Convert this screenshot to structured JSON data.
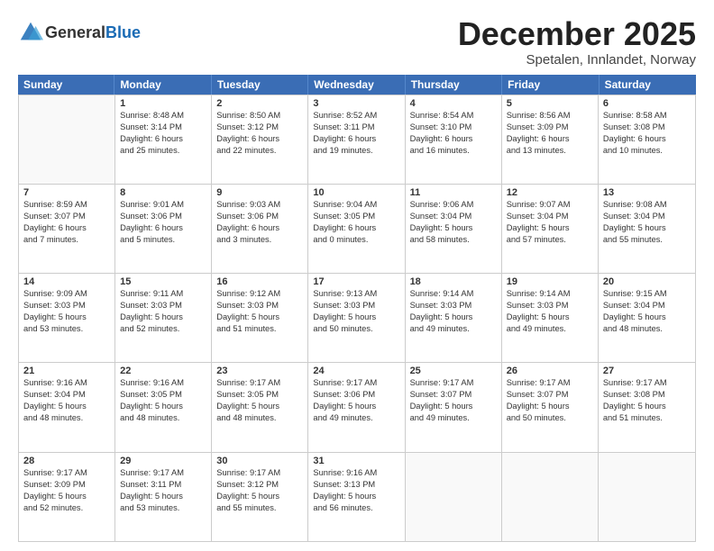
{
  "header": {
    "logo_general": "General",
    "logo_blue": "Blue",
    "month": "December 2025",
    "location": "Spetalen, Innlandet, Norway"
  },
  "weekdays": [
    "Sunday",
    "Monday",
    "Tuesday",
    "Wednesday",
    "Thursday",
    "Friday",
    "Saturday"
  ],
  "rows": [
    [
      {
        "day": "",
        "lines": []
      },
      {
        "day": "1",
        "lines": [
          "Sunrise: 8:48 AM",
          "Sunset: 3:14 PM",
          "Daylight: 6 hours",
          "and 25 minutes."
        ]
      },
      {
        "day": "2",
        "lines": [
          "Sunrise: 8:50 AM",
          "Sunset: 3:12 PM",
          "Daylight: 6 hours",
          "and 22 minutes."
        ]
      },
      {
        "day": "3",
        "lines": [
          "Sunrise: 8:52 AM",
          "Sunset: 3:11 PM",
          "Daylight: 6 hours",
          "and 19 minutes."
        ]
      },
      {
        "day": "4",
        "lines": [
          "Sunrise: 8:54 AM",
          "Sunset: 3:10 PM",
          "Daylight: 6 hours",
          "and 16 minutes."
        ]
      },
      {
        "day": "5",
        "lines": [
          "Sunrise: 8:56 AM",
          "Sunset: 3:09 PM",
          "Daylight: 6 hours",
          "and 13 minutes."
        ]
      },
      {
        "day": "6",
        "lines": [
          "Sunrise: 8:58 AM",
          "Sunset: 3:08 PM",
          "Daylight: 6 hours",
          "and 10 minutes."
        ]
      }
    ],
    [
      {
        "day": "7",
        "lines": [
          "Sunrise: 8:59 AM",
          "Sunset: 3:07 PM",
          "Daylight: 6 hours",
          "and 7 minutes."
        ]
      },
      {
        "day": "8",
        "lines": [
          "Sunrise: 9:01 AM",
          "Sunset: 3:06 PM",
          "Daylight: 6 hours",
          "and 5 minutes."
        ]
      },
      {
        "day": "9",
        "lines": [
          "Sunrise: 9:03 AM",
          "Sunset: 3:06 PM",
          "Daylight: 6 hours",
          "and 3 minutes."
        ]
      },
      {
        "day": "10",
        "lines": [
          "Sunrise: 9:04 AM",
          "Sunset: 3:05 PM",
          "Daylight: 6 hours",
          "and 0 minutes."
        ]
      },
      {
        "day": "11",
        "lines": [
          "Sunrise: 9:06 AM",
          "Sunset: 3:04 PM",
          "Daylight: 5 hours",
          "and 58 minutes."
        ]
      },
      {
        "day": "12",
        "lines": [
          "Sunrise: 9:07 AM",
          "Sunset: 3:04 PM",
          "Daylight: 5 hours",
          "and 57 minutes."
        ]
      },
      {
        "day": "13",
        "lines": [
          "Sunrise: 9:08 AM",
          "Sunset: 3:04 PM",
          "Daylight: 5 hours",
          "and 55 minutes."
        ]
      }
    ],
    [
      {
        "day": "14",
        "lines": [
          "Sunrise: 9:09 AM",
          "Sunset: 3:03 PM",
          "Daylight: 5 hours",
          "and 53 minutes."
        ]
      },
      {
        "day": "15",
        "lines": [
          "Sunrise: 9:11 AM",
          "Sunset: 3:03 PM",
          "Daylight: 5 hours",
          "and 52 minutes."
        ]
      },
      {
        "day": "16",
        "lines": [
          "Sunrise: 9:12 AM",
          "Sunset: 3:03 PM",
          "Daylight: 5 hours",
          "and 51 minutes."
        ]
      },
      {
        "day": "17",
        "lines": [
          "Sunrise: 9:13 AM",
          "Sunset: 3:03 PM",
          "Daylight: 5 hours",
          "and 50 minutes."
        ]
      },
      {
        "day": "18",
        "lines": [
          "Sunrise: 9:14 AM",
          "Sunset: 3:03 PM",
          "Daylight: 5 hours",
          "and 49 minutes."
        ]
      },
      {
        "day": "19",
        "lines": [
          "Sunrise: 9:14 AM",
          "Sunset: 3:03 PM",
          "Daylight: 5 hours",
          "and 49 minutes."
        ]
      },
      {
        "day": "20",
        "lines": [
          "Sunrise: 9:15 AM",
          "Sunset: 3:04 PM",
          "Daylight: 5 hours",
          "and 48 minutes."
        ]
      }
    ],
    [
      {
        "day": "21",
        "lines": [
          "Sunrise: 9:16 AM",
          "Sunset: 3:04 PM",
          "Daylight: 5 hours",
          "and 48 minutes."
        ]
      },
      {
        "day": "22",
        "lines": [
          "Sunrise: 9:16 AM",
          "Sunset: 3:05 PM",
          "Daylight: 5 hours",
          "and 48 minutes."
        ]
      },
      {
        "day": "23",
        "lines": [
          "Sunrise: 9:17 AM",
          "Sunset: 3:05 PM",
          "Daylight: 5 hours",
          "and 48 minutes."
        ]
      },
      {
        "day": "24",
        "lines": [
          "Sunrise: 9:17 AM",
          "Sunset: 3:06 PM",
          "Daylight: 5 hours",
          "and 49 minutes."
        ]
      },
      {
        "day": "25",
        "lines": [
          "Sunrise: 9:17 AM",
          "Sunset: 3:07 PM",
          "Daylight: 5 hours",
          "and 49 minutes."
        ]
      },
      {
        "day": "26",
        "lines": [
          "Sunrise: 9:17 AM",
          "Sunset: 3:07 PM",
          "Daylight: 5 hours",
          "and 50 minutes."
        ]
      },
      {
        "day": "27",
        "lines": [
          "Sunrise: 9:17 AM",
          "Sunset: 3:08 PM",
          "Daylight: 5 hours",
          "and 51 minutes."
        ]
      }
    ],
    [
      {
        "day": "28",
        "lines": [
          "Sunrise: 9:17 AM",
          "Sunset: 3:09 PM",
          "Daylight: 5 hours",
          "and 52 minutes."
        ]
      },
      {
        "day": "29",
        "lines": [
          "Sunrise: 9:17 AM",
          "Sunset: 3:11 PM",
          "Daylight: 5 hours",
          "and 53 minutes."
        ]
      },
      {
        "day": "30",
        "lines": [
          "Sunrise: 9:17 AM",
          "Sunset: 3:12 PM",
          "Daylight: 5 hours",
          "and 55 minutes."
        ]
      },
      {
        "day": "31",
        "lines": [
          "Sunrise: 9:16 AM",
          "Sunset: 3:13 PM",
          "Daylight: 5 hours",
          "and 56 minutes."
        ]
      },
      {
        "day": "",
        "lines": []
      },
      {
        "day": "",
        "lines": []
      },
      {
        "day": "",
        "lines": []
      }
    ]
  ]
}
